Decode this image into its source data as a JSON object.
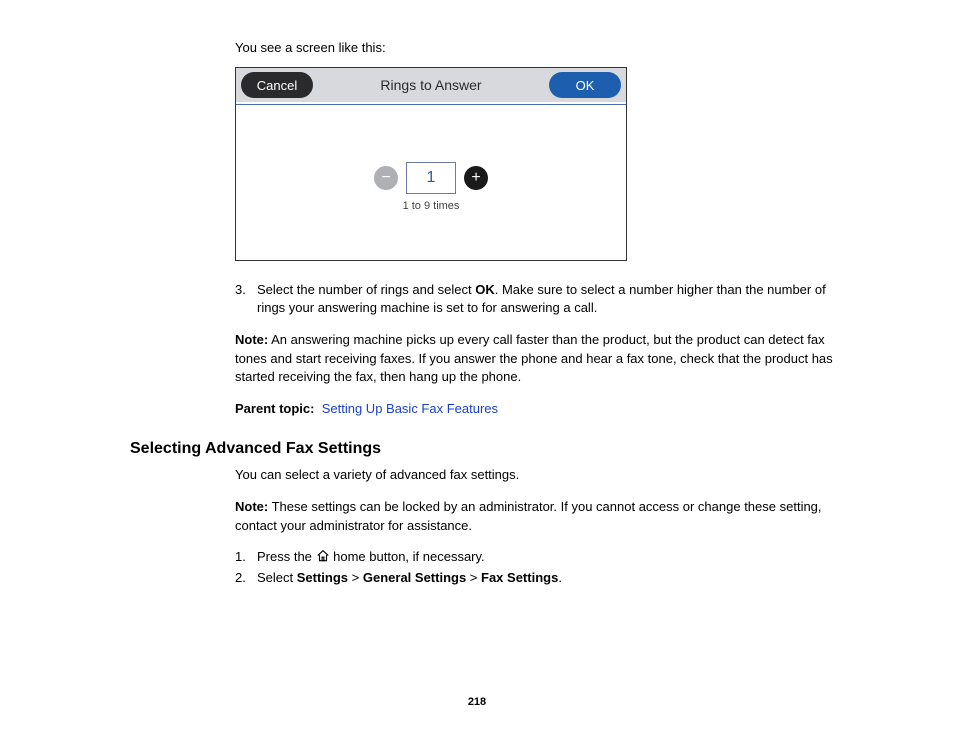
{
  "intro": "You see a screen like this:",
  "screenshot": {
    "cancel": "Cancel",
    "title": "Rings to Answer",
    "ok": "OK",
    "value": "1",
    "caption": "1 to 9 times"
  },
  "step3": {
    "num": "3.",
    "pre": "Select the number of rings and select ",
    "bold": "OK",
    "post": ". Make sure to select a number higher than the number of rings your answering machine is set to for answering a call."
  },
  "note1": {
    "label": "Note:",
    "text": " An answering machine picks up every call faster than the product, but the product can detect fax tones and start receiving faxes. If you answer the phone and hear a fax tone, check that the product has started receiving the fax, then hang up the phone."
  },
  "parent": {
    "label": "Parent topic:",
    "link": "Setting Up Basic Fax Features"
  },
  "section2": {
    "heading": "Selecting Advanced Fax Settings",
    "intro": "You can select a variety of advanced fax settings.",
    "note": {
      "label": "Note:",
      "text": " These settings can be locked by an administrator. If you cannot access or change these setting, contact your administrator for assistance."
    },
    "step1": {
      "num": "1.",
      "pre": "Press the ",
      "post": " home button, if necessary."
    },
    "step2": {
      "num": "2.",
      "pre": "Select ",
      "b1": "Settings",
      "s1": " > ",
      "b2": "General Settings",
      "s2": " > ",
      "b3": "Fax Settings",
      "post": "."
    }
  },
  "pagenum": "218"
}
